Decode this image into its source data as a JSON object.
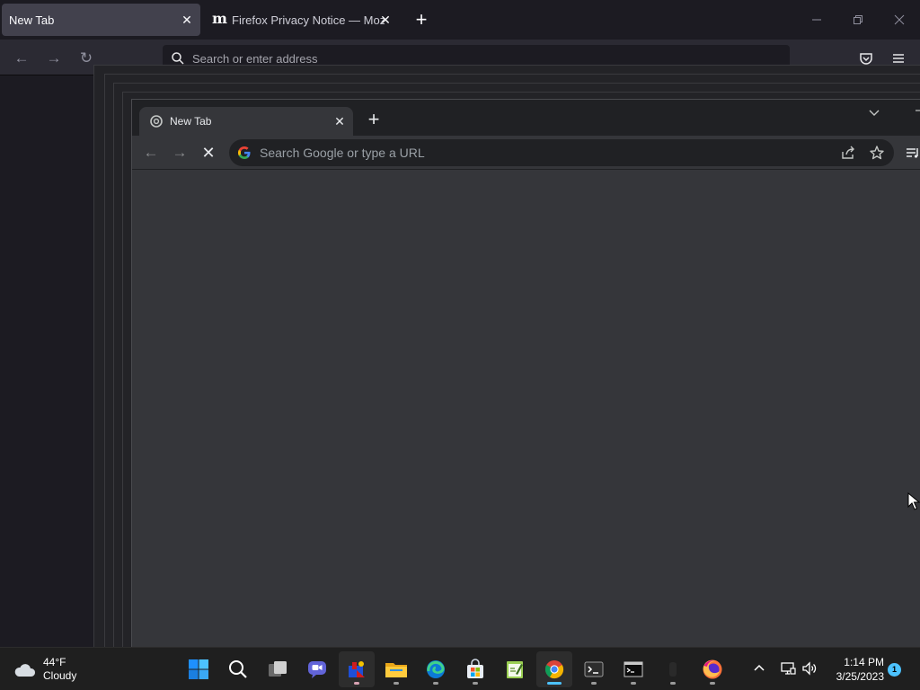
{
  "firefox": {
    "tabs": [
      {
        "title": "New Tab"
      },
      {
        "title": "Firefox Privacy Notice — Mozill"
      }
    ],
    "address_placeholder": "Search or enter address"
  },
  "chrome": {
    "tab_title": "New Tab",
    "omnibox_placeholder": "Search Google or type a URL"
  },
  "taskbar": {
    "weather": {
      "temperature": "44°F",
      "condition": "Cloudy"
    },
    "apps": [
      "start-icon",
      "search-icon",
      "task-view-icon",
      "chat-icon",
      "media-app-icon",
      "file-explorer-icon",
      "edge-icon",
      "store-icon",
      "notepad-icon",
      "chrome-icon",
      "terminal-icon",
      "command-prompt-icon",
      "hidden-app-icon",
      "firefox-icon"
    ],
    "clock": {
      "time": "1:14 PM",
      "date": "3/25/2023"
    },
    "notification_count": "1"
  },
  "colors": {
    "accent": "#4cc2ff",
    "firefox_bg": "#1c1b22",
    "chrome_bg": "#35363a"
  }
}
